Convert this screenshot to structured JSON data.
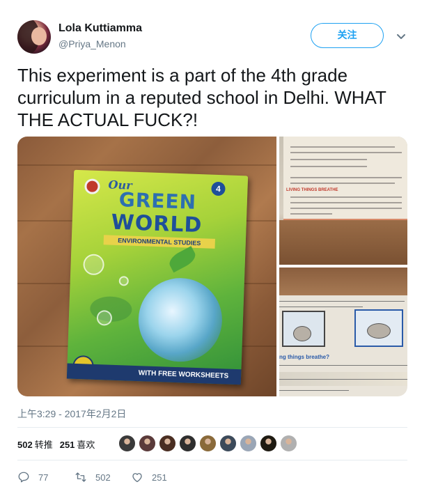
{
  "user": {
    "display_name": "Lola Kuttiamma",
    "handle": "@Priya_Menon",
    "follow_label": "关注"
  },
  "tweet": {
    "text": "This experiment is a part of the 4th grade curriculum in a reputed school in Delhi. WHAT THE ACTUAL FUCK?!",
    "timestamp": "上午3:29 - 2017年2月2日"
  },
  "media": {
    "book": {
      "our": "Our",
      "title_line1": "GREEN",
      "title_line2": "WORLD",
      "subtitle": "ENVIRONMENTAL STUDIES",
      "grade": "4",
      "footer": "WITH FREE WORKSHEETS"
    },
    "page_top": {
      "heading": "LIVING THINGS BREATHE"
    },
    "page_bottom": {
      "heading": "ng things breathe?"
    }
  },
  "stats": {
    "retweets_count": "502",
    "retweets_label": "转推",
    "likes_count": "251",
    "likes_label": "喜欢"
  },
  "likers": [
    {
      "color": "#3a3a3a"
    },
    {
      "color": "#5a3a3a"
    },
    {
      "color": "#4a2e22"
    },
    {
      "color": "#2e2e2e"
    },
    {
      "color": "#8a6a3a"
    },
    {
      "color": "#3c4a5a"
    },
    {
      "color": "#9aa6b6"
    },
    {
      "color": "#1e1a12"
    },
    {
      "color": "#b0b0b0"
    }
  ],
  "actions": {
    "reply_count": "77",
    "retweet_count": "502",
    "like_count": "251"
  },
  "colors": {
    "accent": "#1da1f2",
    "secondary_text": "#657786"
  }
}
